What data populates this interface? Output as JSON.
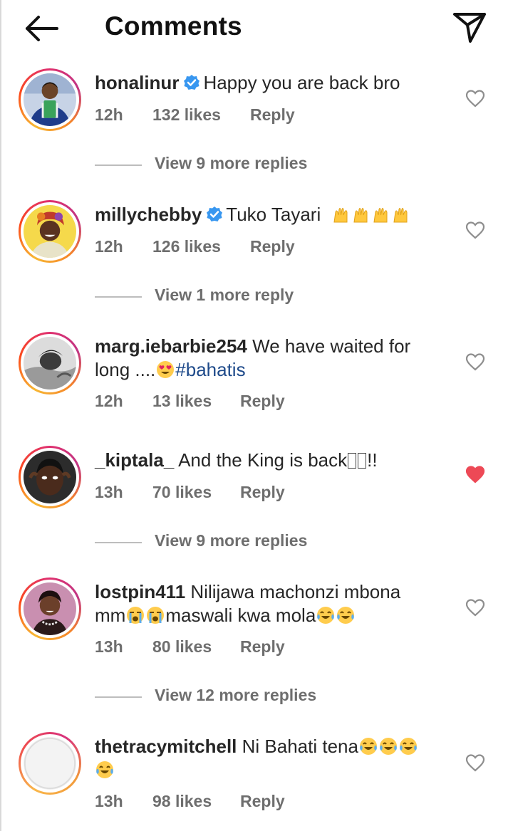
{
  "header": {
    "title": "Comments",
    "back_icon": "arrow-left-icon",
    "send_icon": "paper-plane-icon"
  },
  "comments": [
    {
      "username": "honalinur",
      "verified": true,
      "text": "Happy you are back bro",
      "time": "12h",
      "likes": "132 likes",
      "reply": "Reply",
      "liked": false,
      "view_replies": "View 9 more replies"
    },
    {
      "username": "millychebby",
      "verified": true,
      "text": "Tuko Tayari",
      "emoji": "raising-hands x4",
      "time": "12h",
      "likes": "126 likes",
      "reply": "Reply",
      "liked": false,
      "view_replies": "View 1 more reply"
    },
    {
      "username": "marg.iebarbie254",
      "verified": false,
      "text_line1": "We have waited for",
      "text_line2": "long ....",
      "hashtag": "#bahatis",
      "time": "12h",
      "likes": "13 likes",
      "reply": "Reply",
      "liked": false
    },
    {
      "username": "_kiptala_",
      "verified": false,
      "text": "And the King is back",
      "text_tail": "!!",
      "time": "13h",
      "likes": "70 likes",
      "reply": "Reply",
      "liked": true,
      "view_replies": "View 9 more replies"
    },
    {
      "username": "lostpin411",
      "verified": false,
      "text_line1": "Nilijawa machonzi mbona",
      "text_line2a": "mm",
      "text_line2b": "maswali kwa mola",
      "time": "13h",
      "likes": "80 likes",
      "reply": "Reply",
      "liked": false,
      "view_replies": "View 12 more replies"
    },
    {
      "username": "thetracymitchell",
      "verified": false,
      "text": "Ni Bahati tena",
      "time": "13h",
      "likes": "98 likes",
      "reply": "Reply",
      "liked": false
    }
  ],
  "colors": {
    "text": "#262626",
    "muted": "#6e6e6e",
    "hashtag": "#1e4a8a",
    "liked_heart": "#ed4956",
    "verified": "#3897f0"
  }
}
